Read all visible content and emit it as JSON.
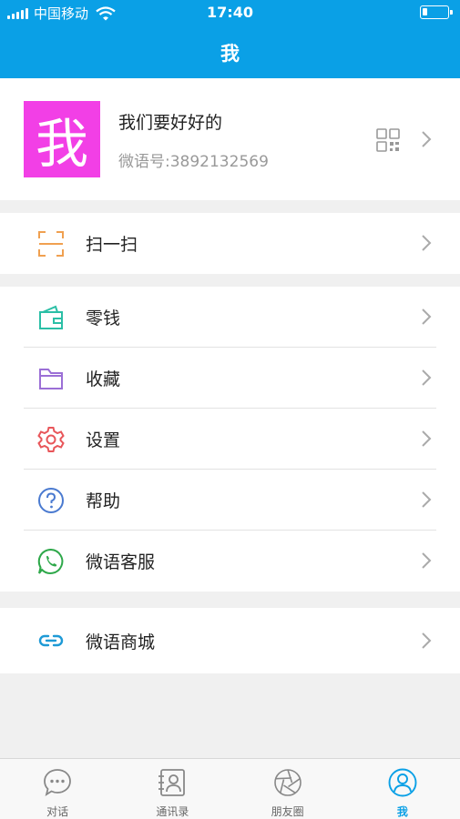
{
  "status_bar": {
    "carrier": "中国移动",
    "time": "17:40",
    "battery_level": 0.2
  },
  "nav": {
    "title": "我"
  },
  "profile": {
    "avatar_char": "我",
    "avatar_color": "#f23fe6",
    "nickname": "我们要好好的",
    "account": "微语号:3892132569"
  },
  "menu": {
    "scan": {
      "label": "扫一扫",
      "icon": "scan-icon",
      "color": "#f0a050"
    },
    "wallet": {
      "label": "零钱",
      "icon": "wallet-icon",
      "color": "#2bbfa6"
    },
    "favorites": {
      "label": "收藏",
      "icon": "folder-icon",
      "color": "#9b6fd6"
    },
    "settings": {
      "label": "设置",
      "icon": "gear-icon",
      "color": "#e8565a"
    },
    "help": {
      "label": "帮助",
      "icon": "help-icon",
      "color": "#4a7ad0"
    },
    "service": {
      "label": "微语客服",
      "icon": "chat-phone-icon",
      "color": "#2ea84a"
    },
    "mall": {
      "label": "微语商城",
      "icon": "link-icon",
      "color": "#1e9ad6"
    }
  },
  "tabs": [
    {
      "label": "对话",
      "icon": "chat-bubble-icon",
      "active": false
    },
    {
      "label": "通讯录",
      "icon": "contacts-icon",
      "active": false
    },
    {
      "label": "朋友圈",
      "icon": "aperture-icon",
      "active": false
    },
    {
      "label": "我",
      "icon": "person-icon",
      "active": true
    }
  ],
  "colors": {
    "accent": "#0aa0e6",
    "background": "#f0f0f0"
  }
}
